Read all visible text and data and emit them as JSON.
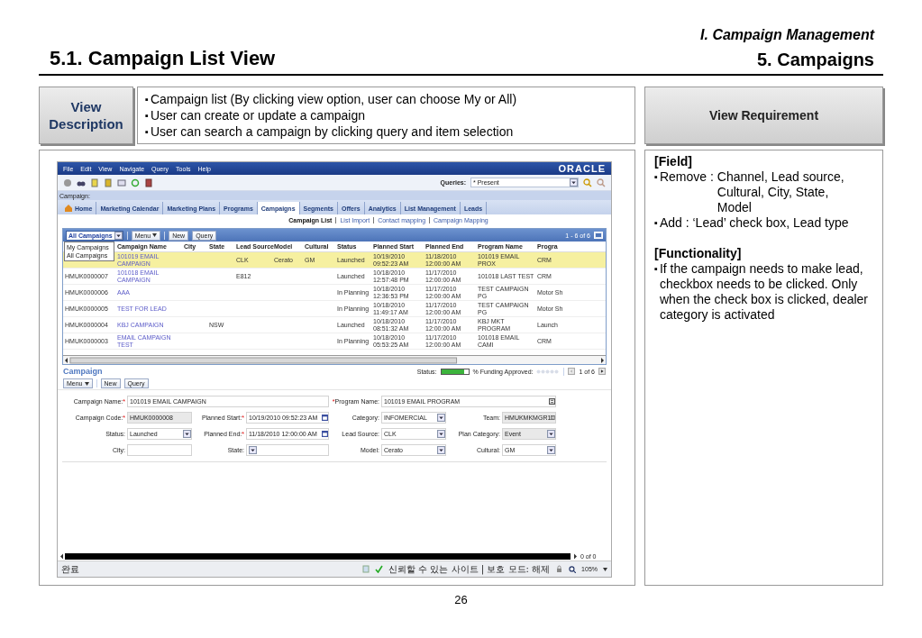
{
  "slide": {
    "section": "I. Campaign Management",
    "title": "5.1. Campaign List View",
    "chapter": "5. Campaigns",
    "page": "26"
  },
  "description": {
    "label": "View Description",
    "bullets": [
      {
        "marker": "▪",
        "text": "Campaign list (By clicking view option, user can choose My or All)"
      },
      {
        "marker": "▪",
        "text": "User can create or update a campaign"
      },
      {
        "marker": "▪",
        "text": "User can search a campaign by clicking query and item selection"
      }
    ]
  },
  "requirement": {
    "label": "View Requirement",
    "sections": [
      {
        "heading": "[Field]",
        "items": [
          {
            "marker": "▪",
            "label": "Remove :",
            "text": "Channel, Lead source, Cultural, City, State, Model"
          },
          {
            "marker": "▪",
            "text": "Add : ‘Lead’ check box, Lead type"
          }
        ]
      },
      {
        "heading": "[Functionality]",
        "items": [
          {
            "marker": "▪",
            "text": "If the campaign needs to make lead, checkbox needs to be clicked. Only when the check box is clicked, dealer category is activated"
          }
        ]
      }
    ]
  },
  "app": {
    "menu": [
      "File",
      "Edit",
      "View",
      "Navigate",
      "Query",
      "Tools",
      "Help"
    ],
    "logo": "ORACLE",
    "queries": {
      "label": "Queries:",
      "value": "* Present"
    },
    "screen_label": "Campaign:",
    "tabs": [
      {
        "label": "Home",
        "selected": false
      },
      {
        "label": "Marketing Calendar",
        "selected": false
      },
      {
        "label": "Marketing Plans",
        "selected": false
      },
      {
        "label": "Programs",
        "selected": false
      },
      {
        "label": "Campaigns",
        "selected": true
      },
      {
        "label": "Segments",
        "selected": false
      },
      {
        "label": "Offers",
        "selected": false
      },
      {
        "label": "Analytics",
        "selected": false
      },
      {
        "label": "List Management",
        "selected": false
      },
      {
        "label": "Leads",
        "selected": false
      }
    ],
    "subtabs": [
      {
        "label": "Campaign List",
        "selected": true
      },
      {
        "label": "List Import",
        "selected": false
      },
      {
        "label": "Contact mapping",
        "selected": false
      },
      {
        "label": "Campaign Mapping",
        "selected": false
      }
    ],
    "list": {
      "view": "All Campaigns",
      "view_options": [
        "My Campaigns",
        "All Campaigns"
      ],
      "buttons": [
        "Menu",
        "New",
        "Query"
      ],
      "count": "1 - 6 of 6",
      "columns": [
        "Campaign Name",
        "City",
        "State",
        "Lead Source",
        "Model",
        "Cultural",
        "Status",
        "Planned Start",
        "Planned End",
        "Program Name",
        "Progra"
      ],
      "rows": [
        {
          "selected": true,
          "name": "101019 EMAIL CAMPAIGN",
          "lead_source": "CLK",
          "model": "Cerato",
          "cultural": "GM",
          "status": "Launched",
          "planned_start": "10/19/2010 09:52:23 AM",
          "planned_end": "11/18/2010 12:00:00 AM",
          "program_name": "101019 EMAIL PROX",
          "column_12": "CRM"
        },
        {
          "selected": false,
          "id": "HMUK0000007",
          "name": "101018 EMAIL CAMPAIGN",
          "lead_source": "E812",
          "status": "Launched",
          "planned_start": "10/18/2010 12:57:48 PM",
          "planned_end": "11/17/2010 12:00:00 AM",
          "program_name": "101018 LAST TEST",
          "column_12": "CRM"
        },
        {
          "selected": false,
          "id": "HMUK0000006",
          "name": "AAA",
          "status": "In Planning",
          "planned_start": "10/18/2010 12:36:53 PM",
          "planned_end": "11/17/2010 12:00:00 AM",
          "program_name": "TEST CAMPAIGN PG",
          "column_12": "Motor Sh"
        },
        {
          "selected": false,
          "id": "HMUK0000005",
          "name": "TEST FOR LEAD",
          "status": "In Planning",
          "planned_start": "10/18/2010 11:49:17 AM",
          "planned_end": "11/17/2010 12:00:00 AM",
          "program_name": "TEST CAMPAIGN PG",
          "column_12": "Motor Sh"
        },
        {
          "selected": false,
          "id": "HMUK0000004",
          "name": "KBJ CAMPAIGN",
          "state": "NSW",
          "status": "Launched",
          "planned_start": "10/18/2010 08:51:32 AM",
          "planned_end": "11/17/2010 12:00:00 AM",
          "program_name": "KBJ MKT PROGRAM",
          "column_12": "Launch"
        },
        {
          "selected": false,
          "id": "HMUK0000003",
          "name": "EMAIL CAMPAIGN TEST",
          "status": "In Planning",
          "planned_start": "10/18/2010 05:53:25 AM",
          "planned_end": "11/17/2010 12:00:00 AM",
          "program_name": "101018 EMAIL CAMI",
          "column_12": "CRM"
        }
      ]
    },
    "form": {
      "title": "Campaign",
      "status_label": "Status:",
      "level": 0.85,
      "funding_label": "% Funding Approved:",
      "record": "1 of 6",
      "buttons": [
        "Menu",
        "New",
        "Query"
      ],
      "fields": [
        {
          "label": "Campaign Name:",
          "required_mark": "*",
          "value": "101019 EMAIL CAMPAIGN",
          "kind": "text",
          "wide": true,
          "readonly": false
        },
        {
          "label": "Program Name:",
          "mark_before": "*",
          "value": "101019 EMAIL PROGRAM",
          "kind": "picker",
          "wide": true,
          "readonly": false
        },
        {
          "label": "Campaign Code:",
          "required_mark": "*",
          "value": "HMUK0000008",
          "kind": "text",
          "wide": false,
          "readonly": true
        },
        {
          "label": "Planned Start:",
          "required_mark": "*",
          "value": "10/19/2010 09:52:23 AM",
          "kind": "date",
          "wide": false,
          "readonly": false
        },
        {
          "label": "Category:",
          "value": "INFOMERCIAL",
          "kind": "select",
          "wide": false,
          "readonly": false
        },
        {
          "label": "Team:",
          "value": "HMUKMKMGR1",
          "kind": "picker",
          "wide": false,
          "readonly": true
        },
        {
          "label": "Status:",
          "value": "Launched",
          "kind": "select",
          "wide": false,
          "readonly": false
        },
        {
          "label": "Planned End:",
          "required_mark": "*",
          "value": "11/18/2010 12:00:00 AM",
          "kind": "date",
          "wide": false,
          "readonly": false
        },
        {
          "label": "Lead Source:",
          "value": "CLK",
          "kind": "select",
          "wide": false,
          "readonly": false
        },
        {
          "label": "Plan Category:",
          "value": "Event",
          "kind": "select",
          "wide": false,
          "readonly": true
        },
        {
          "label": "City:",
          "kind": "text",
          "wide": false,
          "readonly": false
        },
        {
          "label": "State:",
          "kind": "select",
          "wide": false,
          "readonly": false
        },
        {
          "label": "Model:",
          "value": "Cerato",
          "kind": "select",
          "wide": false,
          "readonly": false
        },
        {
          "label": "Cultural:",
          "value": "GM",
          "kind": "select",
          "wide": false,
          "readonly": false
        }
      ]
    },
    "bottom_scroll": "0 of 0",
    "status_bar": {
      "text": "완료",
      "zone": "신뢰할 수 있는 사이트 | 보호 모드: 해제",
      "zoom": "105%"
    }
  }
}
